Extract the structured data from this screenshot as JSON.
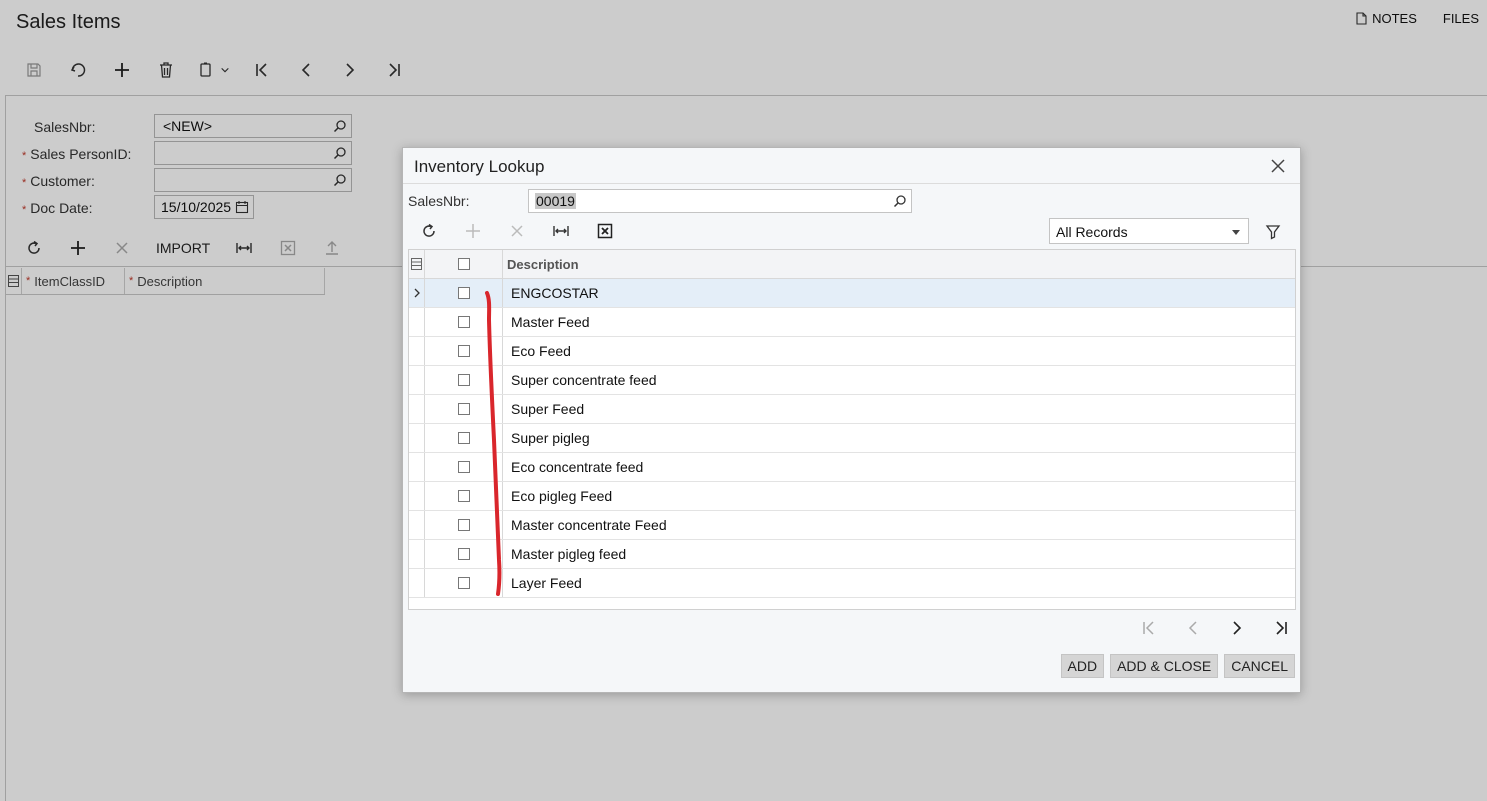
{
  "page": {
    "title": "Sales Items",
    "notes_label": "NOTES",
    "files_label": "FILES"
  },
  "toolbar_icons": [
    "save-icon",
    "undo-icon",
    "add-icon",
    "delete-icon",
    "copy-paste-icon",
    "first-record-icon",
    "previous-record-icon",
    "next-record-icon",
    "last-record-icon"
  ],
  "form": {
    "sales_nbr_label": "SalesNbr:",
    "sales_nbr_value": "<NEW>",
    "sales_person_label": "Sales PersonID:",
    "sales_person_value": "",
    "customer_label": "Customer:",
    "customer_value": "",
    "doc_date_label": "Doc Date:",
    "doc_date_value": "15/10/2025",
    "required_mark": "*"
  },
  "grid": {
    "import_label": "IMPORT",
    "columns": [
      "ItemClassID",
      "Description"
    ]
  },
  "dialog": {
    "title": "Inventory Lookup",
    "sales_nbr_label": "SalesNbr:",
    "sales_nbr_value": "00019",
    "filter_value": "All Records",
    "column_description": "Description",
    "rows": [
      "ENGCOSTAR",
      "Master Feed",
      "Eco Feed",
      "Super concentrate feed",
      "Super Feed",
      "Super pigleg",
      "Eco concentrate feed",
      "Eco pigleg Feed",
      "Master concentrate Feed",
      "Master pigleg feed",
      "Layer Feed"
    ],
    "buttons": {
      "add": "ADD",
      "add_close": "ADD & CLOSE",
      "cancel": "CANCEL"
    }
  },
  "colors": {
    "accent_selected_row": "#e4eef8",
    "annotation": "#d9262c",
    "required": "#c0392b"
  }
}
